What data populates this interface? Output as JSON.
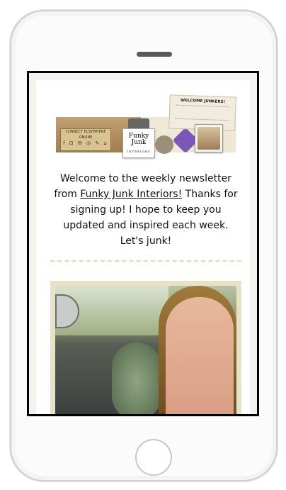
{
  "screen": {
    "banner": {
      "wood_sign_text": "CONNECT ELSEWHERE ONLINE",
      "wood_sign_icons": "f ⊡ ✉ ◎ ✎ ⌂",
      "logo_line1": "Funky",
      "logo_line2": "Junk",
      "logo_sub": "INTERIORS",
      "paper_title": "WELCOME JUNKERS!"
    },
    "intro": {
      "part1": "Welcome to the weekly newsletter from ",
      "link": "Funky Junk Interiors!",
      "part2": " Thanks for signing up!  I hope to keep you updated and inspired each week. Let's junk!"
    }
  },
  "icons": {
    "speaker": "speaker-slot-icon",
    "home": "home-button-icon"
  },
  "colors": {
    "screen_border": "#000000",
    "divider": "#e3dbb0",
    "frame": "#e7e2c7"
  }
}
